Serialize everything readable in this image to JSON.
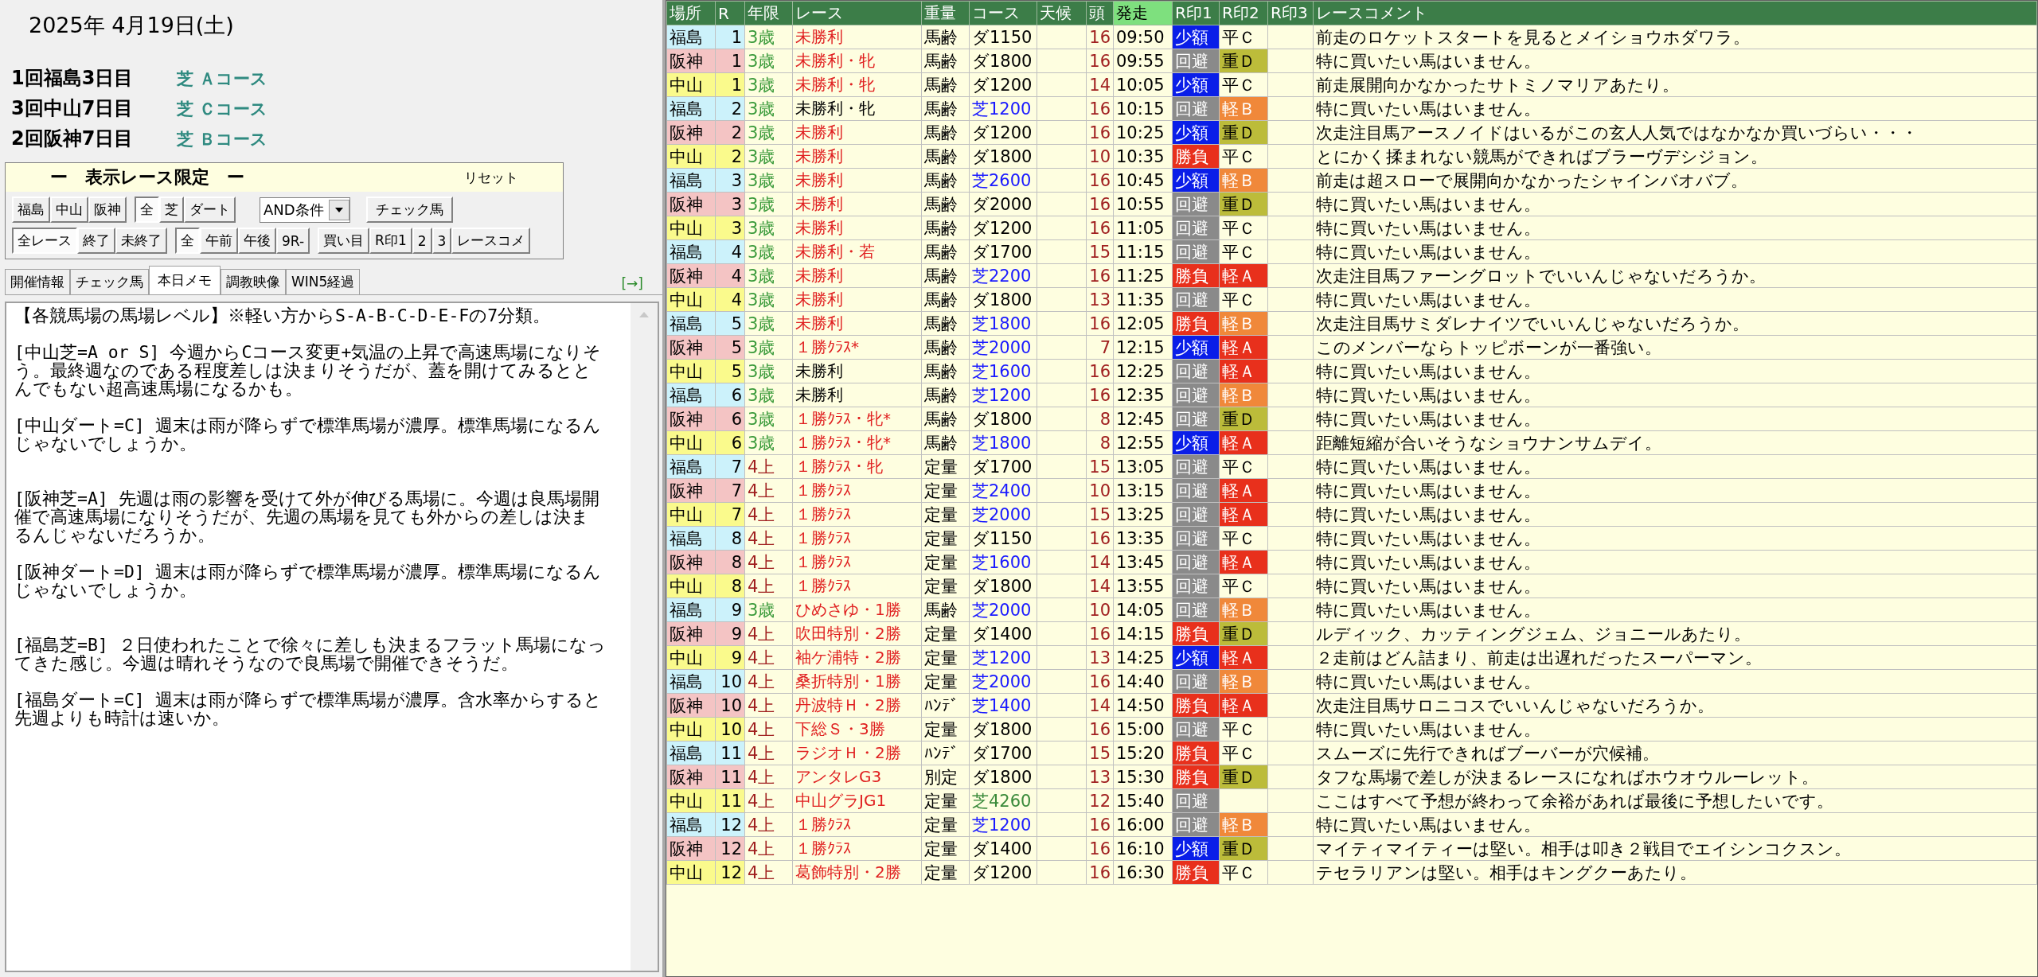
{
  "date": "2025年 4月19日(土)",
  "meetings": [
    {
      "name": "1回福島3日目",
      "course": "芝 Ａコース"
    },
    {
      "name": "3回中山7日目",
      "course": "芝 Ｃコース"
    },
    {
      "name": "2回阪神7日目",
      "course": "芝 Ｂコース"
    }
  ],
  "filter": {
    "title": "ー　表示レース限定　ー",
    "reset": "リセット",
    "row_1": [
      [
        {
          "label": "福島",
          "selected": false
        },
        {
          "label": "中山",
          "selected": false
        },
        {
          "label": "阪神",
          "selected": false
        }
      ],
      [
        {
          "label": "全",
          "selected": true
        },
        {
          "label": "芝",
          "selected": false
        },
        {
          "label": "ダート",
          "selected": false
        }
      ]
    ],
    "condition": "AND条件",
    "check_button": "チェック馬",
    "row_2": [
      [
        {
          "label": "全レース",
          "selected": true
        },
        {
          "label": "終了",
          "selected": false
        },
        {
          "label": "未終了",
          "selected": false
        }
      ],
      [
        {
          "label": "全",
          "selected": true
        },
        {
          "label": "午前",
          "selected": false
        },
        {
          "label": "午後",
          "selected": false
        },
        {
          "label": "9R-",
          "selected": false
        }
      ],
      [
        {
          "label": "買い目",
          "selected": false
        },
        {
          "label": "R印1",
          "selected": false
        },
        {
          "label": "2",
          "selected": false
        },
        {
          "label": "3",
          "selected": false
        },
        {
          "label": "レースコメ",
          "selected": false
        }
      ]
    ]
  },
  "tabs": [
    {
      "label": "開催情報",
      "selected": false
    },
    {
      "label": "チェック馬",
      "selected": false
    },
    {
      "label": "本日メモ",
      "selected": true
    },
    {
      "label": "調教映像",
      "selected": false
    },
    {
      "label": "WIN5経過",
      "selected": false
    }
  ],
  "expand_link": "[→]",
  "memo": "【各競馬場の馬場レベル】※軽い方からS-A-B-C-D-E-Fの7分類。\n\n[中山芝=A or S] 今週からCコース変更+気温の上昇で高速馬場になりそう。最終週なのである程度差しは決まりそうだが、蓋を開けてみるととんでもない超高速馬場になるかも。\n\n[中山ダート=C] 週末は雨が降らずで標準馬場が濃厚。標準馬場になるんじゃないでしょうか。\n\n\n[阪神芝=A] 先週は雨の影響を受けて外が伸びる馬場に。今週は良馬場開催で高速馬場になりそうだが、先週の馬場を見ても外からの差しは決まるんじゃないだろうか。\n\n[阪神ダート=D] 週末は雨が降らずで標準馬場が濃厚。標準馬場になるんじゃないでしょうか。\n\n\n[福島芝=B] ２日使われたことで徐々に差しも決まるフラット馬場になってきた感じ。今週は晴れそうなので良馬場で開催できそうだ。\n\n[福島ダート=C] 週末は雨が降らずで標準馬場が濃厚。含水率からすると先週よりも時計は速いか。",
  "table": {
    "columns": [
      "場所",
      "R",
      "年限",
      "レース",
      "重量",
      "コース",
      "天候",
      "頭",
      "発走",
      "R印1",
      "R印2",
      "R印3",
      "レースコメント"
    ],
    "rows": [
      {
        "venue": "福島",
        "color": "#ccf2fb",
        "r": "1",
        "age": {
          "label": "3歳",
          "kind": "young"
        },
        "race": "未勝利",
        "race_red": true,
        "weight": "馬齢",
        "course": {
          "label": "ダ1150",
          "kind": "dirt"
        },
        "heads": "16",
        "time": "09:50",
        "mark1": {
          "label": "少額",
          "kind": "small"
        },
        "mark2": {
          "label": "平Ｃ",
          "kind": "flat"
        },
        "comment": "前走のロケットスタートを見るとメイショウホダワラ。"
      },
      {
        "venue": "阪神",
        "color": "#f4c4c4",
        "r": "1",
        "age": {
          "label": "3歳",
          "kind": "young"
        },
        "race": "未勝利・牝",
        "race_red": true,
        "weight": "馬齢",
        "course": {
          "label": "ダ1800",
          "kind": "dirt"
        },
        "heads": "16",
        "time": "09:55",
        "mark1": {
          "label": "回避",
          "kind": "skip"
        },
        "mark2": {
          "label": "重Ｄ",
          "kind": "heavy"
        },
        "comment": "特に買いたい馬はいません。"
      },
      {
        "venue": "中山",
        "color": "#fafa8c",
        "r": "1",
        "age": {
          "label": "3歳",
          "kind": "young"
        },
        "race": "未勝利・牝",
        "race_red": true,
        "weight": "馬齢",
        "course": {
          "label": "ダ1200",
          "kind": "dirt"
        },
        "heads": "14",
        "time": "10:05",
        "mark1": {
          "label": "少額",
          "kind": "small"
        },
        "mark2": {
          "label": "平Ｃ",
          "kind": "flat"
        },
        "comment": "前走展開向かなかったサトミノマリアあたり。"
      },
      {
        "venue": "福島",
        "color": "#ccf2fb",
        "r": "2",
        "age": {
          "label": "3歳",
          "kind": "young"
        },
        "race": "未勝利・牝",
        "race_red": false,
        "weight": "馬齢",
        "course": {
          "label": "芝1200",
          "kind": "turf"
        },
        "heads": "16",
        "time": "10:15",
        "mark1": {
          "label": "回避",
          "kind": "skip"
        },
        "mark2": {
          "label": "軽Ｂ",
          "kind": "light_b"
        },
        "comment": "特に買いたい馬はいません。"
      },
      {
        "venue": "阪神",
        "color": "#f4c4c4",
        "r": "2",
        "age": {
          "label": "3歳",
          "kind": "young"
        },
        "race": "未勝利",
        "race_red": true,
        "weight": "馬齢",
        "course": {
          "label": "ダ1200",
          "kind": "dirt"
        },
        "heads": "16",
        "time": "10:25",
        "mark1": {
          "label": "少額",
          "kind": "small"
        },
        "mark2": {
          "label": "重Ｄ",
          "kind": "heavy"
        },
        "comment": "次走注目馬アースノイドはいるがこの玄人人気ではなかなか買いづらい・・・"
      },
      {
        "venue": "中山",
        "color": "#fafa8c",
        "r": "2",
        "age": {
          "label": "3歳",
          "kind": "young"
        },
        "race": "未勝利",
        "race_red": true,
        "weight": "馬齢",
        "course": {
          "label": "ダ1800",
          "kind": "dirt"
        },
        "heads": "10",
        "time": "10:35",
        "mark1": {
          "label": "勝負",
          "kind": "bet"
        },
        "mark2": {
          "label": "平Ｃ",
          "kind": "flat"
        },
        "comment": "とにかく揉まれない競馬ができればブラーヴデシジョン。"
      },
      {
        "venue": "福島",
        "color": "#ccf2fb",
        "r": "3",
        "age": {
          "label": "3歳",
          "kind": "young"
        },
        "race": "未勝利",
        "race_red": true,
        "weight": "馬齢",
        "course": {
          "label": "芝2600",
          "kind": "turf"
        },
        "heads": "16",
        "time": "10:45",
        "mark1": {
          "label": "少額",
          "kind": "small"
        },
        "mark2": {
          "label": "軽Ｂ",
          "kind": "light_b"
        },
        "comment": "前走は超スローで展開向かなかったシャインバオバブ。"
      },
      {
        "venue": "阪神",
        "color": "#f4c4c4",
        "r": "3",
        "age": {
          "label": "3歳",
          "kind": "young"
        },
        "race": "未勝利",
        "race_red": true,
        "weight": "馬齢",
        "course": {
          "label": "ダ2000",
          "kind": "dirt"
        },
        "heads": "16",
        "time": "10:55",
        "mark1": {
          "label": "回避",
          "kind": "skip"
        },
        "mark2": {
          "label": "重Ｄ",
          "kind": "heavy"
        },
        "comment": "特に買いたい馬はいません。"
      },
      {
        "venue": "中山",
        "color": "#fafa8c",
        "r": "3",
        "age": {
          "label": "3歳",
          "kind": "young"
        },
        "race": "未勝利",
        "race_red": true,
        "weight": "馬齢",
        "course": {
          "label": "ダ1200",
          "kind": "dirt"
        },
        "heads": "16",
        "time": "11:05",
        "mark1": {
          "label": "回避",
          "kind": "skip"
        },
        "mark2": {
          "label": "平Ｃ",
          "kind": "flat"
        },
        "comment": "特に買いたい馬はいません。"
      },
      {
        "venue": "福島",
        "color": "#ccf2fb",
        "r": "4",
        "age": {
          "label": "3歳",
          "kind": "young"
        },
        "race": "未勝利・若",
        "race_red": true,
        "weight": "馬齢",
        "course": {
          "label": "ダ1700",
          "kind": "dirt"
        },
        "heads": "15",
        "time": "11:15",
        "mark1": {
          "label": "回避",
          "kind": "skip"
        },
        "mark2": {
          "label": "平Ｃ",
          "kind": "flat"
        },
        "comment": "特に買いたい馬はいません。"
      },
      {
        "venue": "阪神",
        "color": "#f4c4c4",
        "r": "4",
        "age": {
          "label": "3歳",
          "kind": "young"
        },
        "race": "未勝利",
        "race_red": true,
        "weight": "馬齢",
        "course": {
          "label": "芝2200",
          "kind": "turf"
        },
        "heads": "16",
        "time": "11:25",
        "mark1": {
          "label": "勝負",
          "kind": "bet"
        },
        "mark2": {
          "label": "軽Ａ",
          "kind": "light_a"
        },
        "comment": "次走注目馬ファーングロットでいいんじゃないだろうか。"
      },
      {
        "venue": "中山",
        "color": "#fafa8c",
        "r": "4",
        "age": {
          "label": "3歳",
          "kind": "young"
        },
        "race": "未勝利",
        "race_red": true,
        "weight": "馬齢",
        "course": {
          "label": "ダ1800",
          "kind": "dirt"
        },
        "heads": "13",
        "time": "11:35",
        "mark1": {
          "label": "回避",
          "kind": "skip"
        },
        "mark2": {
          "label": "平Ｃ",
          "kind": "flat"
        },
        "comment": "特に買いたい馬はいません。"
      },
      {
        "venue": "福島",
        "color": "#ccf2fb",
        "r": "5",
        "age": {
          "label": "3歳",
          "kind": "young"
        },
        "race": "未勝利",
        "race_red": true,
        "weight": "馬齢",
        "course": {
          "label": "芝1800",
          "kind": "turf"
        },
        "heads": "16",
        "time": "12:05",
        "mark1": {
          "label": "勝負",
          "kind": "bet"
        },
        "mark2": {
          "label": "軽Ｂ",
          "kind": "light_b"
        },
        "comment": "次走注目馬サミダレナイツでいいんじゃないだろうか。"
      },
      {
        "venue": "阪神",
        "color": "#f4c4c4",
        "r": "5",
        "age": {
          "label": "3歳",
          "kind": "young"
        },
        "race": "１勝ｸﾗｽ*",
        "race_red": true,
        "weight": "馬齢",
        "course": {
          "label": "芝2000",
          "kind": "turf"
        },
        "heads": "7",
        "time": "12:15",
        "mark1": {
          "label": "少額",
          "kind": "small"
        },
        "mark2": {
          "label": "軽Ａ",
          "kind": "light_a"
        },
        "comment": "このメンバーならトッピボーンが一番強い。"
      },
      {
        "venue": "中山",
        "color": "#fafa8c",
        "r": "5",
        "age": {
          "label": "3歳",
          "kind": "young"
        },
        "race": "未勝利",
        "race_red": false,
        "weight": "馬齢",
        "course": {
          "label": "芝1600",
          "kind": "turf"
        },
        "heads": "16",
        "time": "12:25",
        "mark1": {
          "label": "回避",
          "kind": "skip"
        },
        "mark2": {
          "label": "軽Ａ",
          "kind": "light_a"
        },
        "comment": "特に買いたい馬はいません。"
      },
      {
        "venue": "福島",
        "color": "#ccf2fb",
        "r": "6",
        "age": {
          "label": "3歳",
          "kind": "young"
        },
        "race": "未勝利",
        "race_red": false,
        "weight": "馬齢",
        "course": {
          "label": "芝1200",
          "kind": "turf"
        },
        "heads": "16",
        "time": "12:35",
        "mark1": {
          "label": "回避",
          "kind": "skip"
        },
        "mark2": {
          "label": "軽Ｂ",
          "kind": "light_b"
        },
        "comment": "特に買いたい馬はいません。"
      },
      {
        "venue": "阪神",
        "color": "#f4c4c4",
        "r": "6",
        "age": {
          "label": "3歳",
          "kind": "young"
        },
        "race": "１勝ｸﾗｽ・牝*",
        "race_red": true,
        "weight": "馬齢",
        "course": {
          "label": "ダ1800",
          "kind": "dirt"
        },
        "heads": "8",
        "time": "12:45",
        "mark1": {
          "label": "回避",
          "kind": "skip"
        },
        "mark2": {
          "label": "重Ｄ",
          "kind": "heavy"
        },
        "comment": "特に買いたい馬はいません。"
      },
      {
        "venue": "中山",
        "color": "#fafa8c",
        "r": "6",
        "age": {
          "label": "3歳",
          "kind": "young"
        },
        "race": "１勝ｸﾗｽ・牝*",
        "race_red": true,
        "weight": "馬齢",
        "course": {
          "label": "芝1800",
          "kind": "turf"
        },
        "heads": "8",
        "time": "12:55",
        "mark1": {
          "label": "少額",
          "kind": "small"
        },
        "mark2": {
          "label": "軽Ａ",
          "kind": "light_a"
        },
        "comment": "距離短縮が合いそうなショウナンサムデイ。"
      },
      {
        "venue": "福島",
        "color": "#ccf2fb",
        "r": "7",
        "age": {
          "label": "4上",
          "kind": "senior"
        },
        "race": "１勝ｸﾗｽ・牝",
        "race_red": true,
        "weight": "定量",
        "course": {
          "label": "ダ1700",
          "kind": "dirt"
        },
        "heads": "15",
        "time": "13:05",
        "mark1": {
          "label": "回避",
          "kind": "skip"
        },
        "mark2": {
          "label": "平Ｃ",
          "kind": "flat"
        },
        "comment": "特に買いたい馬はいません。"
      },
      {
        "venue": "阪神",
        "color": "#f4c4c4",
        "r": "7",
        "age": {
          "label": "4上",
          "kind": "senior"
        },
        "race": "１勝ｸﾗｽ",
        "race_red": true,
        "weight": "定量",
        "course": {
          "label": "芝2400",
          "kind": "turf"
        },
        "heads": "10",
        "time": "13:15",
        "mark1": {
          "label": "回避",
          "kind": "skip"
        },
        "mark2": {
          "label": "軽Ａ",
          "kind": "light_a"
        },
        "comment": "特に買いたい馬はいません。"
      },
      {
        "venue": "中山",
        "color": "#fafa8c",
        "r": "7",
        "age": {
          "label": "4上",
          "kind": "senior"
        },
        "race": "１勝ｸﾗｽ",
        "race_red": true,
        "weight": "定量",
        "course": {
          "label": "芝2000",
          "kind": "turf"
        },
        "heads": "15",
        "time": "13:25",
        "mark1": {
          "label": "回避",
          "kind": "skip"
        },
        "mark2": {
          "label": "軽Ａ",
          "kind": "light_a"
        },
        "comment": "特に買いたい馬はいません。"
      },
      {
        "venue": "福島",
        "color": "#ccf2fb",
        "r": "8",
        "age": {
          "label": "4上",
          "kind": "senior"
        },
        "race": "１勝ｸﾗｽ",
        "race_red": true,
        "weight": "定量",
        "course": {
          "label": "ダ1150",
          "kind": "dirt"
        },
        "heads": "16",
        "time": "13:35",
        "mark1": {
          "label": "回避",
          "kind": "skip"
        },
        "mark2": {
          "label": "平Ｃ",
          "kind": "flat"
        },
        "comment": "特に買いたい馬はいません。"
      },
      {
        "venue": "阪神",
        "color": "#f4c4c4",
        "r": "8",
        "age": {
          "label": "4上",
          "kind": "senior"
        },
        "race": "１勝ｸﾗｽ",
        "race_red": true,
        "weight": "定量",
        "course": {
          "label": "芝1600",
          "kind": "turf"
        },
        "heads": "14",
        "time": "13:45",
        "mark1": {
          "label": "回避",
          "kind": "skip"
        },
        "mark2": {
          "label": "軽Ａ",
          "kind": "light_a"
        },
        "comment": "特に買いたい馬はいません。"
      },
      {
        "venue": "中山",
        "color": "#fafa8c",
        "r": "8",
        "age": {
          "label": "4上",
          "kind": "senior"
        },
        "race": "１勝ｸﾗｽ",
        "race_red": true,
        "weight": "定量",
        "course": {
          "label": "ダ1800",
          "kind": "dirt"
        },
        "heads": "14",
        "time": "13:55",
        "mark1": {
          "label": "回避",
          "kind": "skip"
        },
        "mark2": {
          "label": "平Ｃ",
          "kind": "flat"
        },
        "comment": "特に買いたい馬はいません。"
      },
      {
        "venue": "福島",
        "color": "#ccf2fb",
        "r": "9",
        "age": {
          "label": "3歳",
          "kind": "young"
        },
        "race": "ひめさゆ・1勝",
        "race_red": true,
        "weight": "馬齢",
        "course": {
          "label": "芝2000",
          "kind": "turf"
        },
        "heads": "10",
        "time": "14:05",
        "mark1": {
          "label": "回避",
          "kind": "skip"
        },
        "mark2": {
          "label": "軽Ｂ",
          "kind": "light_b"
        },
        "comment": "特に買いたい馬はいません。"
      },
      {
        "venue": "阪神",
        "color": "#f4c4c4",
        "r": "9",
        "age": {
          "label": "4上",
          "kind": "senior"
        },
        "race": "吹田特別・2勝",
        "race_red": true,
        "weight": "定量",
        "course": {
          "label": "ダ1400",
          "kind": "dirt"
        },
        "heads": "16",
        "time": "14:15",
        "mark1": {
          "label": "勝負",
          "kind": "bet"
        },
        "mark2": {
          "label": "重Ｄ",
          "kind": "heavy"
        },
        "comment": "ルディック、カッティングジェム、ジョニールあたり。"
      },
      {
        "venue": "中山",
        "color": "#fafa8c",
        "r": "9",
        "age": {
          "label": "4上",
          "kind": "senior"
        },
        "race": "袖ケ浦特・2勝",
        "race_red": true,
        "weight": "定量",
        "course": {
          "label": "芝1200",
          "kind": "turf"
        },
        "heads": "13",
        "time": "14:25",
        "mark1": {
          "label": "少額",
          "kind": "small"
        },
        "mark2": {
          "label": "軽Ａ",
          "kind": "light_a"
        },
        "comment": "２走前はどん詰まり、前走は出遅れだったスーパーマン。"
      },
      {
        "venue": "福島",
        "color": "#ccf2fb",
        "r": "10",
        "age": {
          "label": "4上",
          "kind": "senior"
        },
        "race": "桑折特別・1勝",
        "race_red": true,
        "weight": "定量",
        "course": {
          "label": "芝2000",
          "kind": "turf"
        },
        "heads": "16",
        "time": "14:40",
        "mark1": {
          "label": "回避",
          "kind": "skip"
        },
        "mark2": {
          "label": "軽Ｂ",
          "kind": "light_b"
        },
        "comment": "特に買いたい馬はいません。"
      },
      {
        "venue": "阪神",
        "color": "#f4c4c4",
        "r": "10",
        "age": {
          "label": "4上",
          "kind": "senior"
        },
        "race": "丹波特Ｈ・2勝",
        "race_red": true,
        "weight": "ﾊﾝﾃﾞ",
        "course": {
          "label": "芝1400",
          "kind": "turf"
        },
        "heads": "14",
        "time": "14:50",
        "mark1": {
          "label": "勝負",
          "kind": "bet"
        },
        "mark2": {
          "label": "軽Ａ",
          "kind": "light_a"
        },
        "comment": "次走注目馬サロニコスでいいんじゃないだろうか。"
      },
      {
        "venue": "中山",
        "color": "#fafa8c",
        "r": "10",
        "age": {
          "label": "4上",
          "kind": "senior"
        },
        "race": "下総Ｓ・3勝",
        "race_red": true,
        "weight": "定量",
        "course": {
          "label": "ダ1800",
          "kind": "dirt"
        },
        "heads": "16",
        "time": "15:00",
        "mark1": {
          "label": "回避",
          "kind": "skip"
        },
        "mark2": {
          "label": "平Ｃ",
          "kind": "flat"
        },
        "comment": "特に買いたい馬はいません。"
      },
      {
        "venue": "福島",
        "color": "#ccf2fb",
        "r": "11",
        "age": {
          "label": "4上",
          "kind": "senior"
        },
        "race": "ラジオＨ・2勝",
        "race_red": true,
        "weight": "ﾊﾝﾃﾞ",
        "course": {
          "label": "ダ1700",
          "kind": "dirt"
        },
        "heads": "15",
        "time": "15:20",
        "mark1": {
          "label": "勝負",
          "kind": "bet"
        },
        "mark2": {
          "label": "平Ｃ",
          "kind": "flat"
        },
        "comment": "スムーズに先行できればブーバーが穴候補。"
      },
      {
        "venue": "阪神",
        "color": "#f4c4c4",
        "r": "11",
        "age": {
          "label": "4上",
          "kind": "senior"
        },
        "race": "アンタレG3",
        "race_red": true,
        "weight": "別定",
        "course": {
          "label": "ダ1800",
          "kind": "dirt"
        },
        "heads": "13",
        "time": "15:30",
        "mark1": {
          "label": "勝負",
          "kind": "bet"
        },
        "mark2": {
          "label": "重Ｄ",
          "kind": "heavy"
        },
        "comment": "タフな馬場で差しが決まるレースになればホウオウルーレット。"
      },
      {
        "venue": "中山",
        "color": "#fafa8c",
        "r": "11",
        "age": {
          "label": "4上",
          "kind": "senior"
        },
        "race": "中山グラJG1",
        "race_red": true,
        "weight": "定量",
        "course": {
          "label": "芝4260",
          "kind": "jump"
        },
        "heads": "12",
        "time": "15:40",
        "mark1": {
          "label": "回避",
          "kind": "skip"
        },
        "comment": "ここはすべて予想が終わって余裕があれば最後に予想したいです。"
      },
      {
        "venue": "福島",
        "color": "#ccf2fb",
        "r": "12",
        "age": {
          "label": "4上",
          "kind": "senior"
        },
        "race": "１勝ｸﾗｽ",
        "race_red": true,
        "weight": "定量",
        "course": {
          "label": "芝1200",
          "kind": "turf"
        },
        "heads": "16",
        "time": "16:00",
        "mark1": {
          "label": "回避",
          "kind": "skip"
        },
        "mark2": {
          "label": "軽Ｂ",
          "kind": "light_b"
        },
        "comment": "特に買いたい馬はいません。"
      },
      {
        "venue": "阪神",
        "color": "#f4c4c4",
        "r": "12",
        "age": {
          "label": "4上",
          "kind": "senior"
        },
        "race": "１勝ｸﾗｽ",
        "race_red": true,
        "weight": "定量",
        "course": {
          "label": "ダ1400",
          "kind": "dirt"
        },
        "heads": "16",
        "time": "16:10",
        "mark1": {
          "label": "少額",
          "kind": "small"
        },
        "mark2": {
          "label": "重Ｄ",
          "kind": "heavy"
        },
        "comment": "マイティマイティーは堅い。相手は叩き２戦目でエイシンコクスン。"
      },
      {
        "venue": "中山",
        "color": "#fafa8c",
        "r": "12",
        "age": {
          "label": "4上",
          "kind": "senior"
        },
        "race": "葛飾特別・2勝",
        "race_red": true,
        "weight": "定量",
        "course": {
          "label": "ダ1200",
          "kind": "dirt"
        },
        "heads": "16",
        "time": "16:30",
        "mark1": {
          "label": "勝負",
          "kind": "bet"
        },
        "mark2": {
          "label": "平Ｃ",
          "kind": "flat"
        },
        "comment": "テセラリアンは堅い。相手はキングクーあたり。"
      }
    ]
  }
}
